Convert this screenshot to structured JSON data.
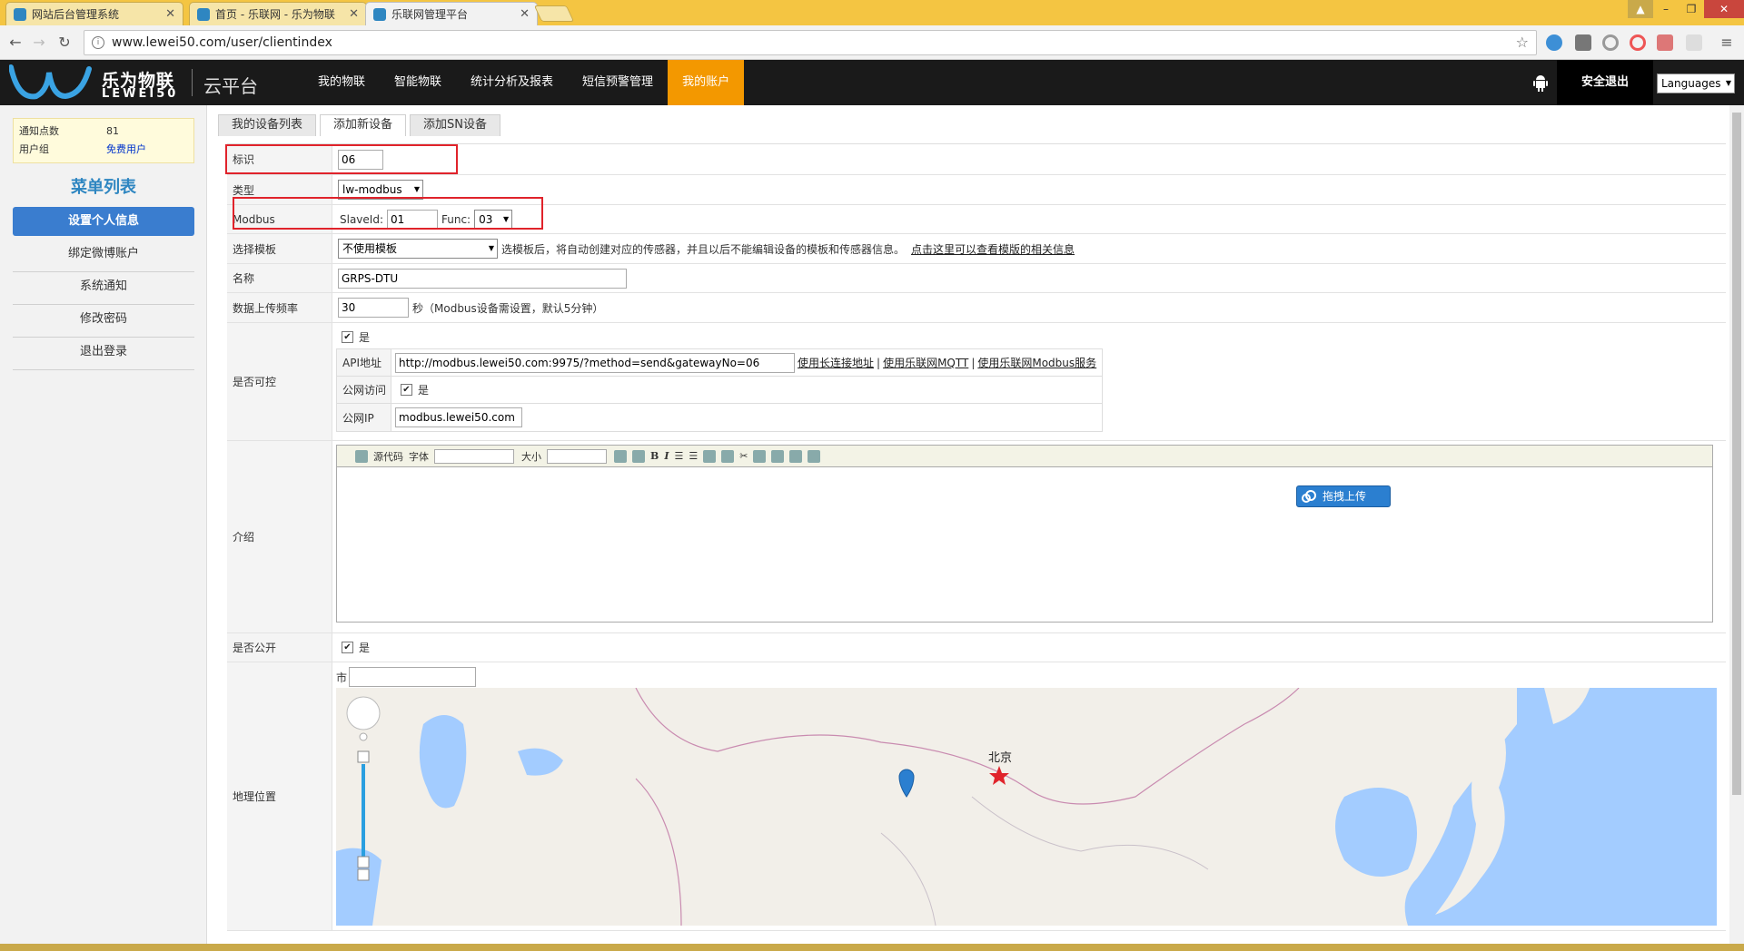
{
  "browser": {
    "tabs": [
      {
        "title": "网站后台管理系统"
      },
      {
        "title": "首页 - 乐联网 - 乐为物联"
      },
      {
        "title": "乐联网管理平台"
      }
    ],
    "url": "www.lewei50.com/user/clientindex"
  },
  "header": {
    "logo_cn": "乐为物联",
    "logo_en": "LEWEI50",
    "platform": "云平台",
    "nav": [
      "我的物联",
      "智能物联",
      "统计分析及报表",
      "短信预警管理",
      "我的账户"
    ],
    "active_nav": "我的账户",
    "logout": "安全退出",
    "languages": "Languages"
  },
  "sidebar": {
    "info": [
      {
        "key": "通知点数",
        "value": "81"
      },
      {
        "key": "用户组",
        "value": "免费用户"
      }
    ],
    "menu_title": "菜单列表",
    "items": [
      "设置个人信息",
      "绑定微博账户",
      "系统通知",
      "修改密码",
      "退出登录"
    ]
  },
  "tabs": [
    "我的设备列表",
    "添加新设备",
    "添加SN设备"
  ],
  "form": {
    "id_label": "标识",
    "id_value": "06",
    "type_label": "类型",
    "type_value": "lw-modbus",
    "modbus_label": "Modbus",
    "slave_label": "SlaveId:",
    "slave_value": "01",
    "func_label": "Func:",
    "func_value": "03",
    "template_label": "选择模板",
    "template_value": "不使用模板",
    "template_note": "选模板后，将自动创建对应的传感器，并且以后不能编辑设备的模板和传感器信息。",
    "template_link": "点击这里可以查看模版的相关信息",
    "name_label": "名称",
    "name_value": "GRPS-DTU",
    "freq_label": "数据上传频率",
    "freq_value": "30",
    "freq_note": "秒（Modbus设备需设置，默认5分钟）",
    "control_label": "是否可控",
    "control_yes": "是",
    "api_label": "API地址",
    "api_value": "http://modbus.lewei50.com:9975/?method=send&gatewayNo=06",
    "api_links": [
      "使用长连接地址",
      "使用乐联网MQTT",
      "使用乐联网Modbus服务"
    ],
    "public_access_label": "公网访问",
    "public_access_yes": "是",
    "public_ip_label": "公网IP",
    "public_ip_value": "modbus.lewei50.com",
    "intro_label": "介绍",
    "editor_toolbar": {
      "source": "源代码",
      "font": "字体",
      "size": "大小"
    },
    "upload_button": "拖拽上传",
    "public_label": "是否公开",
    "public_yes": "是",
    "geo_label": "地理位置",
    "city_label": "市",
    "map_city": "北京"
  },
  "colors": {
    "accent_orange": "#f39800",
    "header_bg": "#1a1a1a",
    "sidebar_active": "#3a7dcf",
    "highlight_red": "#e0232b",
    "map_water": "#a3ccff"
  }
}
